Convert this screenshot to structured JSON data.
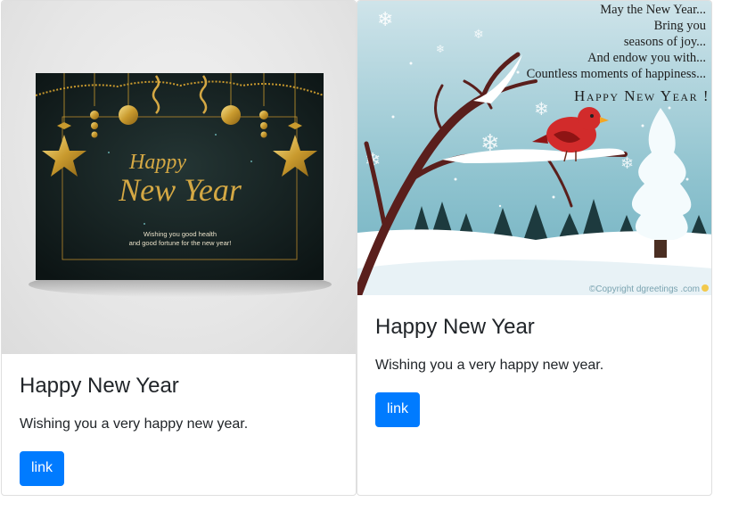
{
  "cards": [
    {
      "title": "Happy New Year",
      "text": "Wishing you a very happy new year.",
      "button_label": "link",
      "image": {
        "headline_line1": "Happy",
        "headline_line2": "New Year",
        "subtext_line1": "Wishing you good health",
        "subtext_line2": "and good fortune for the new year!"
      }
    },
    {
      "title": "Happy New Year",
      "text": "Wishing you a very happy new year.",
      "button_label": "link",
      "image": {
        "poem": [
          "May the New Year...",
          "Bring you",
          "seasons of joy...",
          "And endow you with...",
          "Countless moments of happiness..."
        ],
        "headline": "Happy New Year !",
        "copyright": "©Copyright dgreetings .com"
      }
    }
  ],
  "colors": {
    "button": "#007bff",
    "gold": "#d4a844"
  }
}
